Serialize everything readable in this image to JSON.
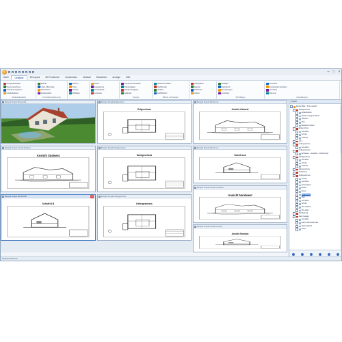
{
  "menu_tabs": [
    "Datei",
    "Gebäude",
    "3D-Layout",
    "3D-Funktionen",
    "Konstruktion",
    "Gelände",
    "Bearbeiten",
    "Anzeige",
    "Hilfe"
  ],
  "active_tab_index": 1,
  "ribbon_groups": [
    {
      "label": "Gebäudeassistent",
      "items": [
        "Neugebäudeplan",
        "Neues Geschoss",
        "Geschoss kopieren",
        "Gebäudedaten"
      ]
    },
    {
      "label": "Konstruktionselemente",
      "items": [
        "Wände",
        "Unter-/Überzüge",
        "Schornstein",
        "Deckenplatte"
      ]
    },
    {
      "label": "",
      "items": [
        "Stützen",
        "Türen",
        "Fenster",
        "Rollladen"
      ]
    },
    {
      "label": "",
      "items": [
        "Stürze",
        "Aussparung",
        "Fensterbank",
        "Kontraste"
      ]
    },
    {
      "label": "Treppen",
      "items": [
        "Treppenkonstruktion",
        "Treppendaten",
        "Treppenausgang",
        "Geländer"
      ]
    },
    {
      "label": "Dächer und Gauben",
      "items": [
        "Dachkonstruktion",
        "Dachfenster",
        "Gauben",
        "Dachflächen"
      ]
    },
    {
      "label": "",
      "items": [
        "Dachplatten",
        "Sparren",
        "Dachrinne",
        "Kehlen"
      ]
    },
    {
      "label": "Schnittlagen",
      "items": [
        "Auflagen",
        "Raumbuch",
        "Bemaßungen",
        "Ansichten"
      ]
    },
    {
      "label": "Ausstattungen",
      "items": [
        "Ansichten",
        "Konstruktion anheben",
        "Grundriss",
        "Planung"
      ]
    }
  ],
  "documents": [
    {
      "caption": "Beispiel Projekt 3D-Ansicht",
      "title": "",
      "kind": "photo"
    },
    {
      "caption": "Beispiel Projekt Erdgeschoss",
      "title": "Erdgeschoss",
      "kind": "plan"
    },
    {
      "caption": "Beispiel Projekt Schnitt A-A",
      "title": "Ansicht Ostwest",
      "kind": "elevation"
    },
    {
      "caption": "Beispiel Projekt Ansicht Südwest",
      "title": "Ansicht Südwest",
      "kind": "elevation"
    },
    {
      "caption": "Beispiel Projekt Dachgeschoss",
      "title": "Dachgeschoss",
      "kind": "plan"
    },
    {
      "caption": "Beispiel Projekt Schnitt A-A",
      "title": "Schnitt A-A",
      "kind": "section"
    },
    {
      "caption": "Beispiel Projekt Schnitt B-B",
      "title": "Schnitt B-B",
      "kind": "section"
    },
    {
      "caption": "Beispiel Projekt Kellergeschoss",
      "title": "Kellergeschoss",
      "kind": "plan"
    },
    {
      "caption": "Beispiel Projekt Ansicht Nordwest",
      "title": "Ansicht Nordwest",
      "kind": "elevation"
    },
    {
      "caption": "Beispiel Projekt Ansicht Nordost",
      "title": "Ansicht Nordost",
      "kind": "section"
    }
  ],
  "panel": {
    "title": "Projekt",
    "tree": [
      {
        "label": "Arbeits Blatt - Test auswahl",
        "depth": 0,
        "icon": "folder"
      },
      {
        "label": "Dachgeschoss",
        "depth": 1,
        "icon": "floor"
      },
      {
        "label": "Außenwände",
        "depth": 2,
        "icon": "layer"
      },
      {
        "label": "Vorbau Carage Fahrrad",
        "depth": 2,
        "icon": "layer"
      },
      {
        "label": "Pflanzen",
        "depth": 2,
        "icon": "layer"
      },
      {
        "label": "Plan",
        "depth": 2,
        "icon": "layer"
      },
      {
        "label": "Bauwerk Fenster",
        "depth": 2,
        "icon": "layer"
      },
      {
        "label": "Erdgeschoss",
        "depth": 1,
        "icon": "floor"
      },
      {
        "label": "Grundriss",
        "depth": 2,
        "icon": "layer"
      },
      {
        "label": "Schnitt",
        "depth": 2,
        "icon": "layer"
      },
      {
        "label": "Gelände",
        "depth": 2,
        "icon": "layer"
      },
      {
        "label": "A.17",
        "depth": 1,
        "icon": "floor"
      },
      {
        "label": "Kellergeschoss",
        "depth": 1,
        "icon": "floor"
      },
      {
        "label": "Grundriss",
        "depth": 2,
        "icon": "layer"
      },
      {
        "label": "Kellergeschoss",
        "depth": 1,
        "icon": "floor"
      },
      {
        "label": "Einbauten - Geländer - Dachfenster",
        "depth": 2,
        "icon": "layer"
      },
      {
        "label": "Dachgeschoss",
        "depth": 1,
        "icon": "floor"
      },
      {
        "label": "Grundriss",
        "depth": 2,
        "icon": "layer"
      },
      {
        "label": "Schnitt",
        "depth": 2,
        "icon": "layer"
      },
      {
        "label": "Gelände",
        "depth": 2,
        "icon": "layer"
      },
      {
        "label": "Obergeschoss",
        "depth": 1,
        "icon": "floor"
      },
      {
        "label": "Schnitt A-A",
        "depth": 1,
        "icon": "floor"
      },
      {
        "label": "Kellergeschoss",
        "depth": 1,
        "icon": "floor"
      },
      {
        "label": "Schnitt",
        "depth": 2,
        "icon": "layer"
      },
      {
        "label": "Grundriss",
        "depth": 2,
        "icon": "layer"
      },
      {
        "label": "Schwenkbar",
        "depth": 2,
        "icon": "layer"
      },
      {
        "label": "Böden",
        "depth": 2,
        "icon": "layer"
      },
      {
        "label": "Textur",
        "depth": 2,
        "icon": "layer"
      },
      {
        "label": "3D-Fläche",
        "depth": 2,
        "icon": "layer",
        "selected": true
      },
      {
        "label": "Plan",
        "depth": 2,
        "icon": "layer"
      },
      {
        "label": "Grundriss",
        "depth": 2,
        "icon": "layer"
      },
      {
        "label": "Schnitt",
        "depth": 2,
        "icon": "layer"
      },
      {
        "label": "3D Laufwerk",
        "depth": 2,
        "icon": "layer"
      },
      {
        "label": "3D Laden",
        "depth": 2,
        "icon": "layer"
      },
      {
        "label": "Dachlattung",
        "depth": 1,
        "icon": "floor"
      },
      {
        "label": "Dach Carage",
        "depth": 1,
        "icon": "floor"
      },
      {
        "label": "Grundriss",
        "depth": 2,
        "icon": "layer"
      },
      {
        "label": "Dach Kellerpauschale",
        "depth": 2,
        "icon": "layer"
      },
      {
        "label": "Dach Fahrrad",
        "depth": 2,
        "icon": "layer"
      },
      {
        "label": "Textur",
        "depth": 2,
        "icon": "layer"
      }
    ]
  },
  "status_text": "Parkhaus Startseite",
  "colors": {
    "accent": "#3876c9",
    "chrome": "#e9eef5",
    "border": "#9db1c9"
  }
}
